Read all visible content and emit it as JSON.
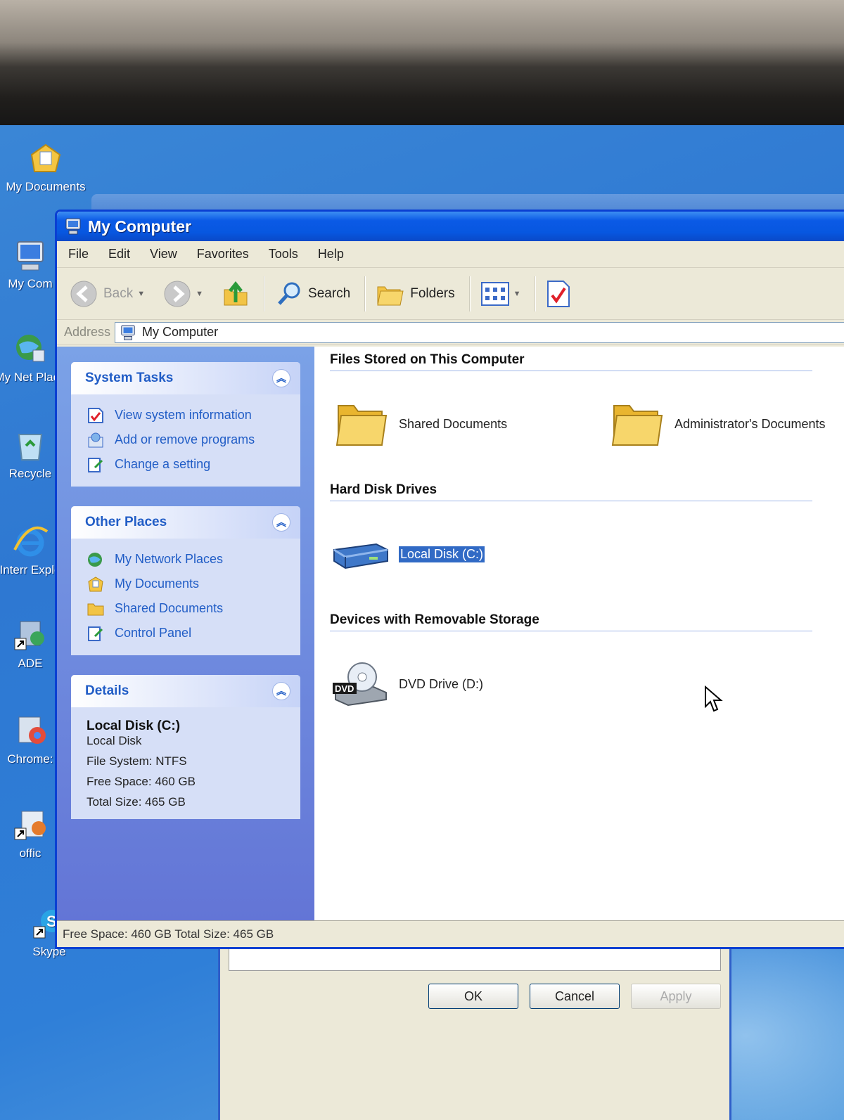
{
  "desktop": {
    "icons": [
      {
        "label": "My Documents",
        "icon": "my-documents-icon"
      },
      {
        "label": "My Com",
        "icon": "my-computer-icon"
      },
      {
        "label": "My Net Place",
        "icon": "my-network-places-icon"
      },
      {
        "label": "Recycle",
        "icon": "recycle-bin-icon"
      },
      {
        "label": "Interr Explo",
        "icon": "internet-explorer-icon"
      },
      {
        "label": "ADE",
        "icon": "shortcut-icon"
      },
      {
        "label": "Chrome:",
        "icon": "shortcut-icon"
      },
      {
        "label": "offic",
        "icon": "shortcut-icon"
      },
      {
        "label": "Skype",
        "icon": "skype-icon"
      }
    ]
  },
  "dialog": {
    "buttons": {
      "ok": "OK",
      "cancel": "Cancel",
      "apply": "Apply"
    }
  },
  "window": {
    "title": "My Computer",
    "menu": [
      "File",
      "Edit",
      "View",
      "Favorites",
      "Tools",
      "Help"
    ],
    "toolbar": {
      "back": "Back",
      "search": "Search",
      "folders": "Folders"
    },
    "address": {
      "label": "Address",
      "value": "My Computer"
    },
    "taskpane": {
      "system_tasks": {
        "title": "System Tasks",
        "links": [
          "View system information",
          "Add or remove programs",
          "Change a setting"
        ]
      },
      "other_places": {
        "title": "Other Places",
        "links": [
          "My Network Places",
          "My Documents",
          "Shared Documents",
          "Control Panel"
        ]
      },
      "details": {
        "title": "Details",
        "name": "Local Disk (C:)",
        "type": "Local Disk",
        "file_system": "File System: NTFS",
        "free_space": "Free Space: 460 GB",
        "total_size": "Total Size: 465 GB"
      }
    },
    "groups": {
      "files_stored": {
        "title": "Files Stored on This Computer",
        "items": [
          "Shared Documents",
          "Administrator's Documents"
        ]
      },
      "hard_disks": {
        "title": "Hard Disk Drives",
        "items": [
          "Local Disk (C:)"
        ]
      },
      "removable": {
        "title": "Devices with Removable Storage",
        "items": [
          "DVD Drive (D:)"
        ],
        "dvd_badge": "DVD"
      }
    },
    "status": "Free Space: 460 GB Total Size: 465 GB"
  },
  "colors": {
    "title_blue": "#0757e0",
    "task_link": "#215dc6",
    "selection": "#316ac5"
  }
}
